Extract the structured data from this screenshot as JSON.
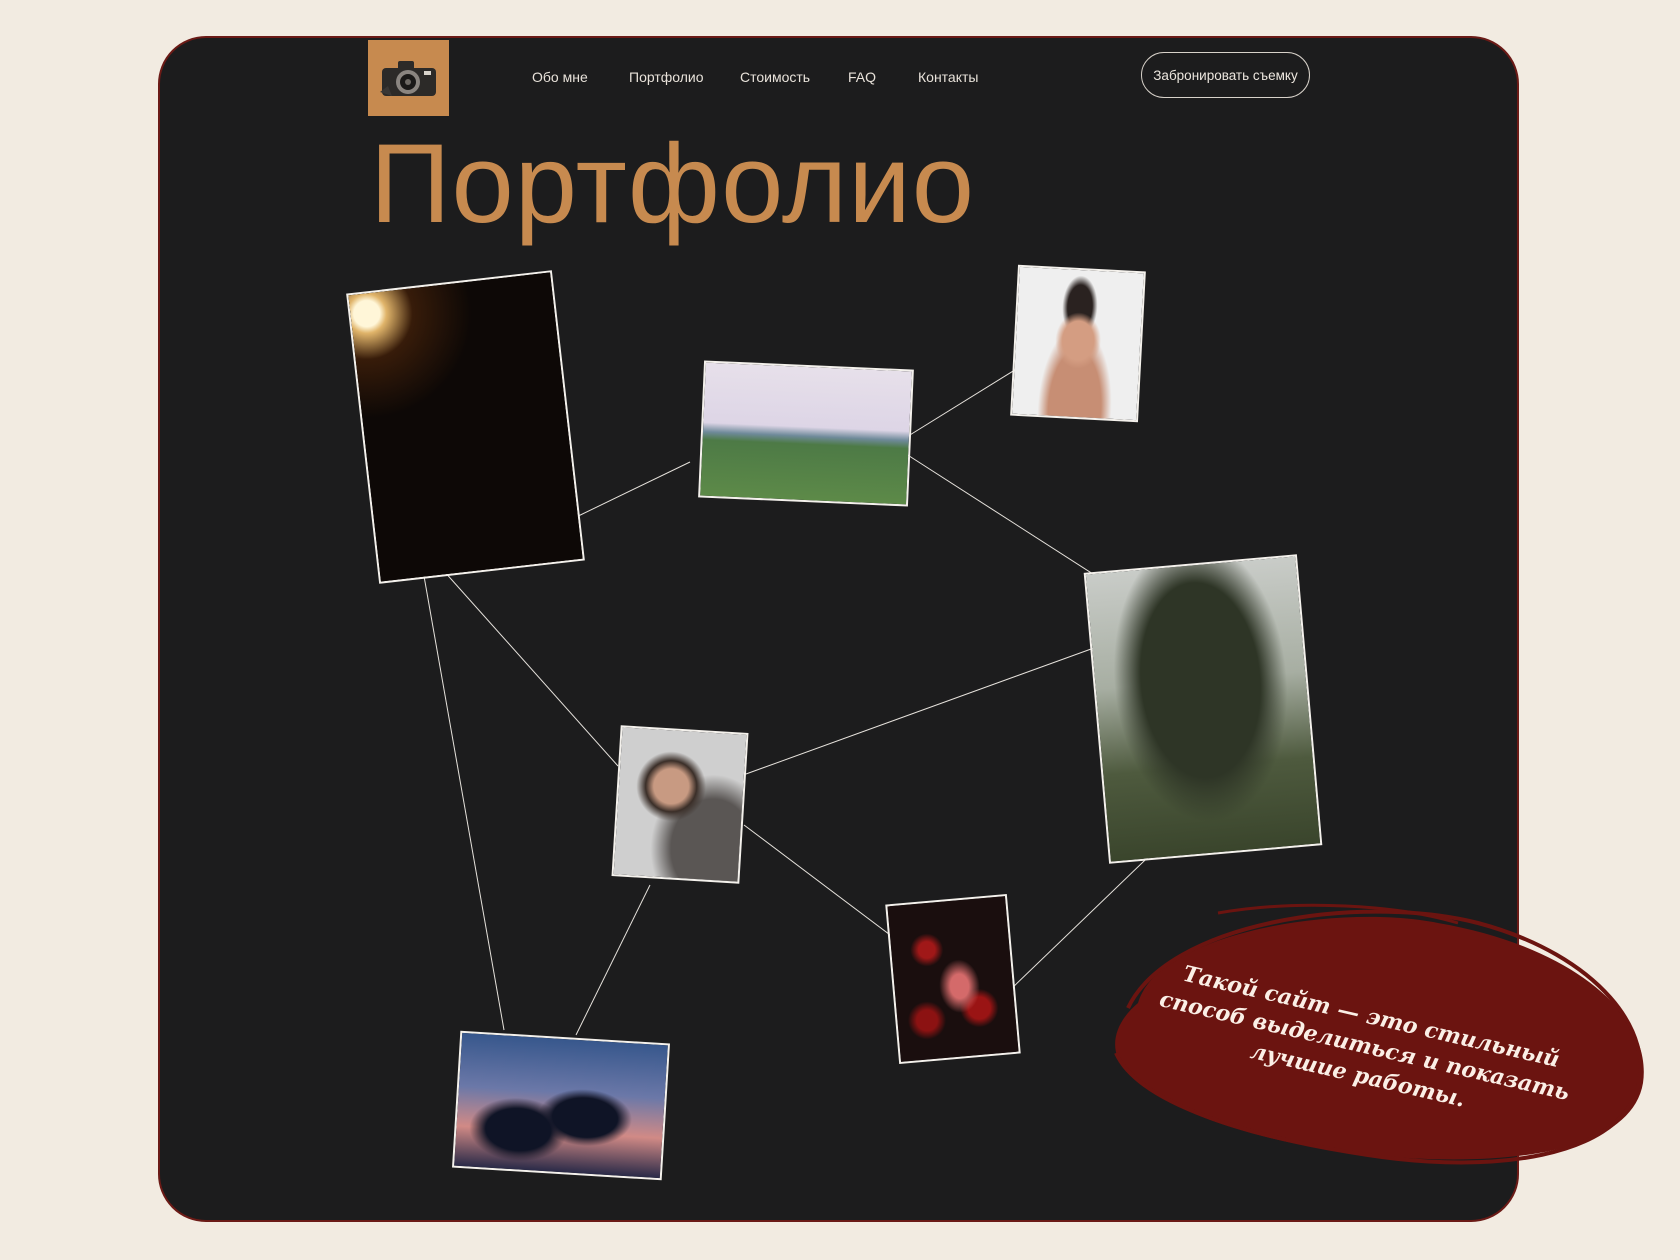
{
  "nav": {
    "items": [
      "Обо мне",
      "Портфолио",
      "Стоимость",
      "FAQ",
      "Контакты"
    ],
    "book_button": "Забронировать съемку"
  },
  "page": {
    "title": "Портфолио"
  },
  "callout": {
    "text": "Такой сайт — это стильный способ выделиться и показать лучшие работы."
  },
  "colors": {
    "accent": "#c78a4f",
    "background": "#1c1c1d",
    "page": "#f2ebe1",
    "callout": "#6b1410"
  },
  "icons": {
    "logo": "camera-icon"
  }
}
